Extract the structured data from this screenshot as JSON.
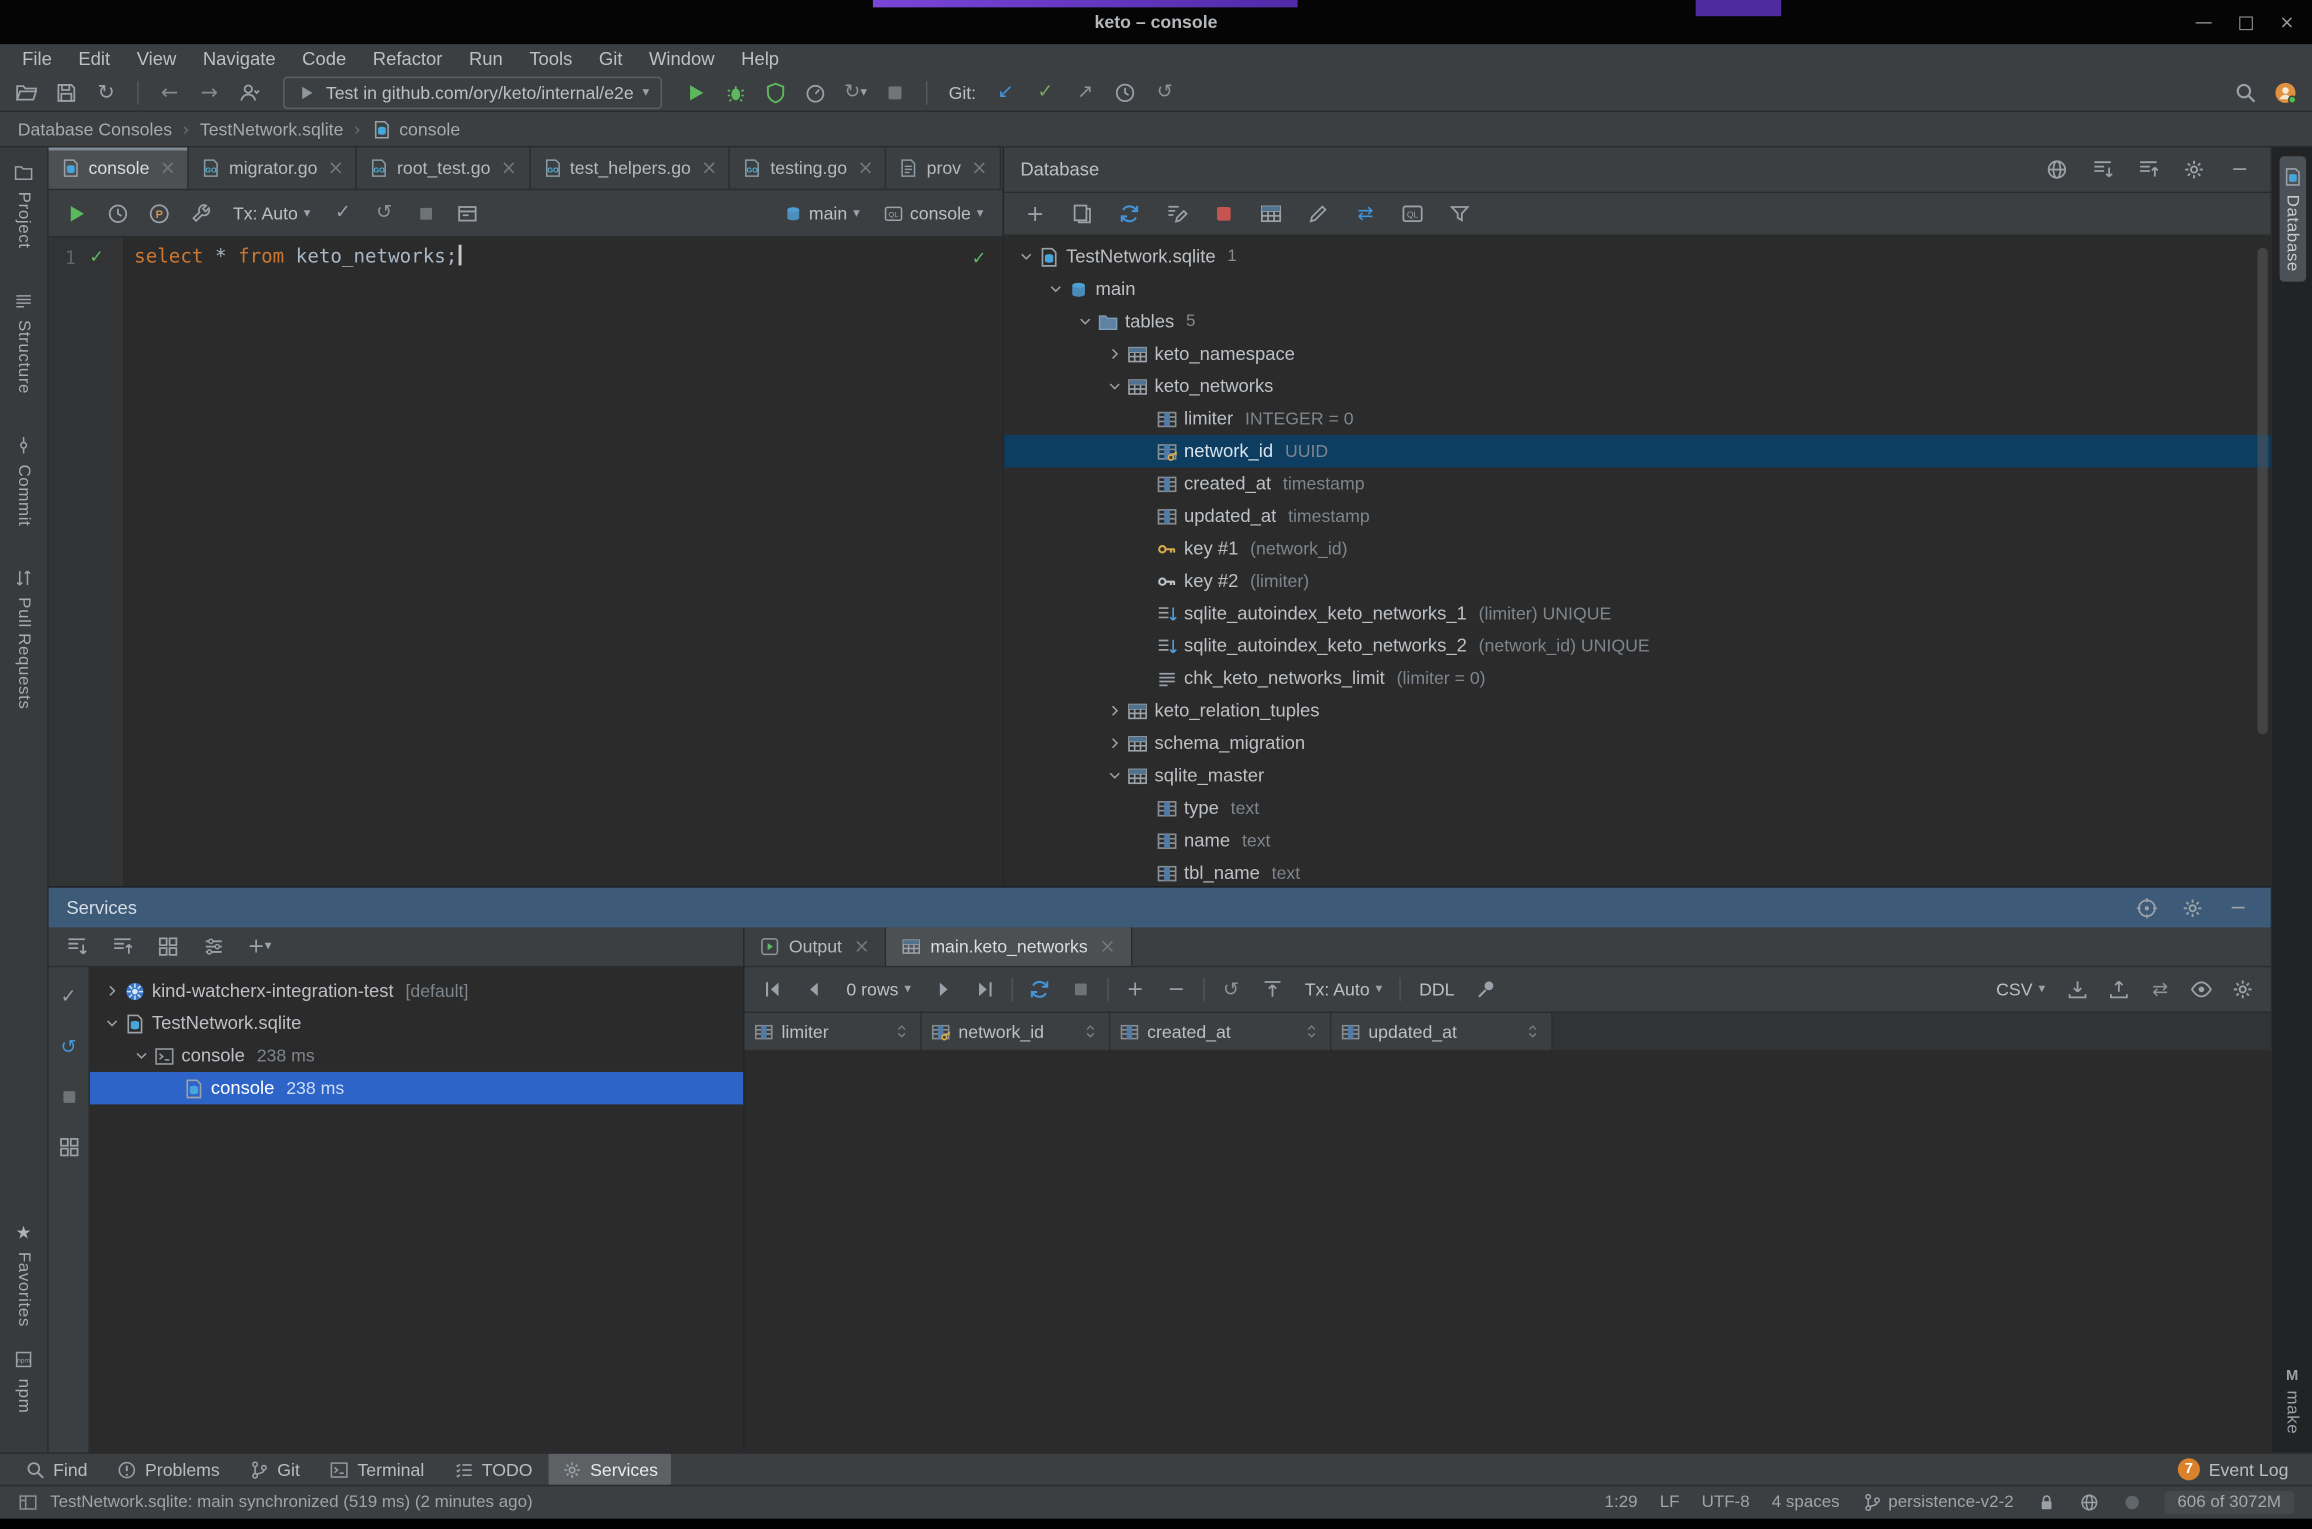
{
  "window": {
    "title": "keto – console"
  },
  "menu": {
    "items": [
      "File",
      "Edit",
      "View",
      "Navigate",
      "Code",
      "Refactor",
      "Run",
      "Tools",
      "Git",
      "Window",
      "Help"
    ]
  },
  "toolbar": {
    "run_config": "Test in github.com/ory/keto/internal/e2e",
    "git_label": "Git:",
    "left_icons": [
      "open-folder",
      "save",
      "sync"
    ],
    "nav_icons": [
      "back",
      "forward"
    ],
    "run_icons": [
      "run",
      "debug",
      "coverage",
      "profiler",
      "rerun",
      "stop"
    ],
    "git_icons": [
      "update",
      "commit",
      "push",
      "history",
      "rollback"
    ],
    "right_icons": [
      "search",
      "avatar"
    ]
  },
  "breadcrumbs": {
    "items": [
      "Database Consoles",
      "TestNetwork.sqlite",
      "console"
    ]
  },
  "left_stripe": {
    "top": [
      {
        "label": "Project",
        "icon": "folder-sm"
      },
      {
        "label": "Structure",
        "icon": "lines-sm"
      },
      {
        "label": "Commit",
        "icon": "commit-sm"
      },
      {
        "label": "Pull Requests",
        "icon": "pr-sm"
      }
    ],
    "bottom": [
      {
        "label": "Favorites",
        "icon": "star"
      },
      {
        "label": "npm",
        "icon": "box-sm"
      }
    ]
  },
  "right_stripe": {
    "top_label": "Database",
    "bottom_label": "make",
    "bottom_icon_letter": "M"
  },
  "editor": {
    "tabs": [
      {
        "label": "console",
        "icon": "dbfile",
        "active": true
      },
      {
        "label": "migrator.go",
        "icon": "gofile"
      },
      {
        "label": "root_test.go",
        "icon": "gofile"
      },
      {
        "label": "test_helpers.go",
        "icon": "gofile"
      },
      {
        "label": "testing.go",
        "icon": "gofile"
      },
      {
        "label": "prov",
        "icon": "file"
      }
    ],
    "toolbar": {
      "icons_left": [
        "execute",
        "history",
        "parameters",
        "wrench"
      ],
      "tx_label": "Tx: Auto",
      "icons_mid": [
        "commit-check",
        "rollback",
        "stop-gray2",
        "output-mode"
      ],
      "schema": "main",
      "session": "console"
    },
    "line_number": "1",
    "code_tokens": [
      {
        "text": "select",
        "type": "keyword"
      },
      {
        "text": " * ",
        "type": "plain"
      },
      {
        "text": "from",
        "type": "keyword"
      },
      {
        "text": " keto_networks",
        "type": "plain"
      },
      {
        "text": ";",
        "type": "plain"
      }
    ]
  },
  "database": {
    "title": "Database",
    "header_icons": [
      "web",
      "expand-all",
      "collapse-all",
      "gear",
      "hide"
    ],
    "toolbar_icons": [
      "add",
      "duplicate",
      "refresh",
      "edit-source",
      "stop-red",
      "table-view",
      "edit",
      "swap",
      "query-console",
      "filter"
    ],
    "tree": [
      {
        "indent": 0,
        "chevron": "down",
        "icon": "dbfile",
        "label": "TestNetwork.sqlite",
        "badge": "1"
      },
      {
        "indent": 1,
        "chevron": "down",
        "icon": "schema",
        "label": "main"
      },
      {
        "indent": 2,
        "chevron": "down",
        "icon": "folder",
        "label": "tables",
        "badge": "5"
      },
      {
        "indent": 3,
        "chevron": "right",
        "icon": "table",
        "label": "keto_namespace"
      },
      {
        "indent": 3,
        "chevron": "down",
        "icon": "table",
        "label": "keto_networks"
      },
      {
        "indent": 4,
        "chevron": null,
        "icon": "column",
        "label": "limiter",
        "meta": "INTEGER = 0"
      },
      {
        "indent": 4,
        "chevron": null,
        "icon": "colkey",
        "label": "network_id",
        "meta": "UUID",
        "selected": true
      },
      {
        "indent": 4,
        "chevron": null,
        "icon": "column",
        "label": "created_at",
        "meta": "timestamp"
      },
      {
        "indent": 4,
        "chevron": null,
        "icon": "column",
        "label": "updated_at",
        "meta": "timestamp"
      },
      {
        "indent": 4,
        "chevron": null,
        "icon": "key-gold",
        "label": "key #1",
        "meta": "(network_id)"
      },
      {
        "indent": 4,
        "chevron": null,
        "icon": "key-gray",
        "label": "key #2",
        "meta": "(limiter)"
      },
      {
        "indent": 4,
        "chevron": null,
        "icon": "index",
        "label": "sqlite_autoindex_keto_networks_1",
        "meta": "(limiter) UNIQUE"
      },
      {
        "indent": 4,
        "chevron": null,
        "icon": "index",
        "label": "sqlite_autoindex_keto_networks_2",
        "meta": "(network_id) UNIQUE"
      },
      {
        "indent": 4,
        "chevron": null,
        "icon": "lines",
        "label": "chk_keto_networks_limit",
        "meta": "(limiter = 0)"
      },
      {
        "indent": 3,
        "chevron": "right",
        "icon": "table",
        "label": "keto_relation_tuples"
      },
      {
        "indent": 3,
        "chevron": "right",
        "icon": "table",
        "label": "schema_migration"
      },
      {
        "indent": 3,
        "chevron": "down",
        "icon": "table",
        "label": "sqlite_master"
      },
      {
        "indent": 4,
        "chevron": null,
        "icon": "column",
        "label": "type",
        "meta": "text"
      },
      {
        "indent": 4,
        "chevron": null,
        "icon": "column",
        "label": "name",
        "meta": "text"
      },
      {
        "indent": 4,
        "chevron": null,
        "icon": "column",
        "label": "tbl_name",
        "meta": "text"
      }
    ]
  },
  "services": {
    "title": "Services",
    "header_icons": [
      "target",
      "gear",
      "hide"
    ],
    "toolbar_icons": [
      "expand-all",
      "collapse-all",
      "group",
      "view-options",
      "add-service"
    ],
    "side_icons": [
      "check",
      "rollback-blue",
      "stop-gray2",
      "grid"
    ],
    "tree": [
      {
        "indent": 0,
        "chevron": "right",
        "icon": "kind",
        "label": "kind-watcherx-integration-test",
        "meta": "[default]"
      },
      {
        "indent": 0,
        "chevron": "down",
        "icon": "dbfile",
        "label": "TestNetwork.sqlite"
      },
      {
        "indent": 1,
        "chevron": "down",
        "icon": "term",
        "label": "console",
        "meta": "238 ms"
      },
      {
        "indent": 2,
        "chevron": null,
        "icon": "dbfile",
        "label": "console",
        "meta": "238 ms",
        "selected": true
      }
    ],
    "output_tabs": [
      {
        "label": "Output",
        "icon": "runtab"
      },
      {
        "label": "main.keto_networks",
        "icon": "table",
        "active": true
      }
    ],
    "grid": {
      "rows_label": "0 rows",
      "tx_label": "Tx: Auto",
      "ddl_label": "DDL",
      "csv_label": "CSV",
      "columns": [
        {
          "name": "limiter",
          "icon": "column"
        },
        {
          "name": "network_id",
          "icon": "colkey"
        },
        {
          "name": "created_at",
          "icon": "column"
        },
        {
          "name": "updated_at",
          "icon": "column"
        }
      ]
    }
  },
  "bottom_bar": {
    "buttons": [
      {
        "label": "Find",
        "icon": "search"
      },
      {
        "label": "Problems",
        "icon": "problems"
      },
      {
        "label": "Git",
        "icon": "branch"
      },
      {
        "label": "Terminal",
        "icon": "term"
      },
      {
        "label": "TODO",
        "icon": "todo"
      },
      {
        "label": "Services",
        "icon": "gear",
        "active": true
      }
    ],
    "event_count": "7",
    "event_label": "Event Log"
  },
  "status_bar": {
    "left_label": "TestNetwork.sqlite: main synchronized (519 ms) (2 minutes ago)",
    "caret_position": "1:29",
    "line_ending": "LF",
    "encoding": "UTF-8",
    "indent_style": "4 spaces",
    "branch": "persistence-v2-2",
    "memory": "606 of 3072M"
  }
}
